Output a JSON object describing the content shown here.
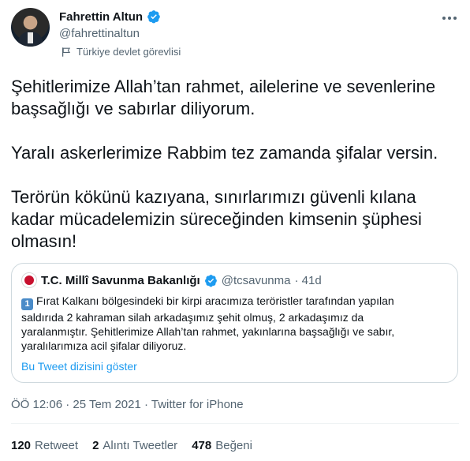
{
  "author": {
    "name": "Fahrettin Altun",
    "handle": "@fahrettinaltun",
    "label": "Türkiye devlet görevlisi",
    "verified": true
  },
  "tweet": {
    "paragraphs": [
      "Şehitlerimize Allah’tan rahmet, ailelerine ve sevenlerine\nbaşsağlığı ve sabırlar diliyorum.",
      "Yaralı askerlerimize Rabbim tez zamanda şifalar versin.",
      "Terörün kökünü kazıyana, sınırlarımızı güvenli kılana\nkadar mücadelemizin süreceğinden kimsenin şüphesi\nolmasın!"
    ]
  },
  "quoted": {
    "name": "T.C. Millî Savunma Bakanlığı",
    "handle": "@tcsavunma",
    "age": "· 41d",
    "number_badge": "1",
    "text": "Fırat Kalkanı bölgesindeki bir kirpi aracımıza teröristler tarafından yapılan\nsaldırıda 2 kahraman silah arkadaşımız şehit olmuş, 2 arkadaşımız da\nyaralanmıştır. Şehitlerimize Allah’tan rahmet, yakınlarına başsağlığı ve sabır,\nyaralılarımıza acil şifalar diliyoruz.",
    "thread_link": "Bu Tweet dizisini göster"
  },
  "timestamp": "ÖÖ 12:06 · 25 Tem 2021 · Twitter for iPhone",
  "stats": {
    "retweets_num": "120",
    "retweets_label": "Retweet",
    "quotes_num": "2",
    "quotes_label": "Alıntı Tweetler",
    "likes_num": "478",
    "likes_label": "Beğeni"
  },
  "colors": {
    "verified_badge": "#1d9bf0",
    "link": "#1d9bf0",
    "secondary_text": "#536471"
  }
}
